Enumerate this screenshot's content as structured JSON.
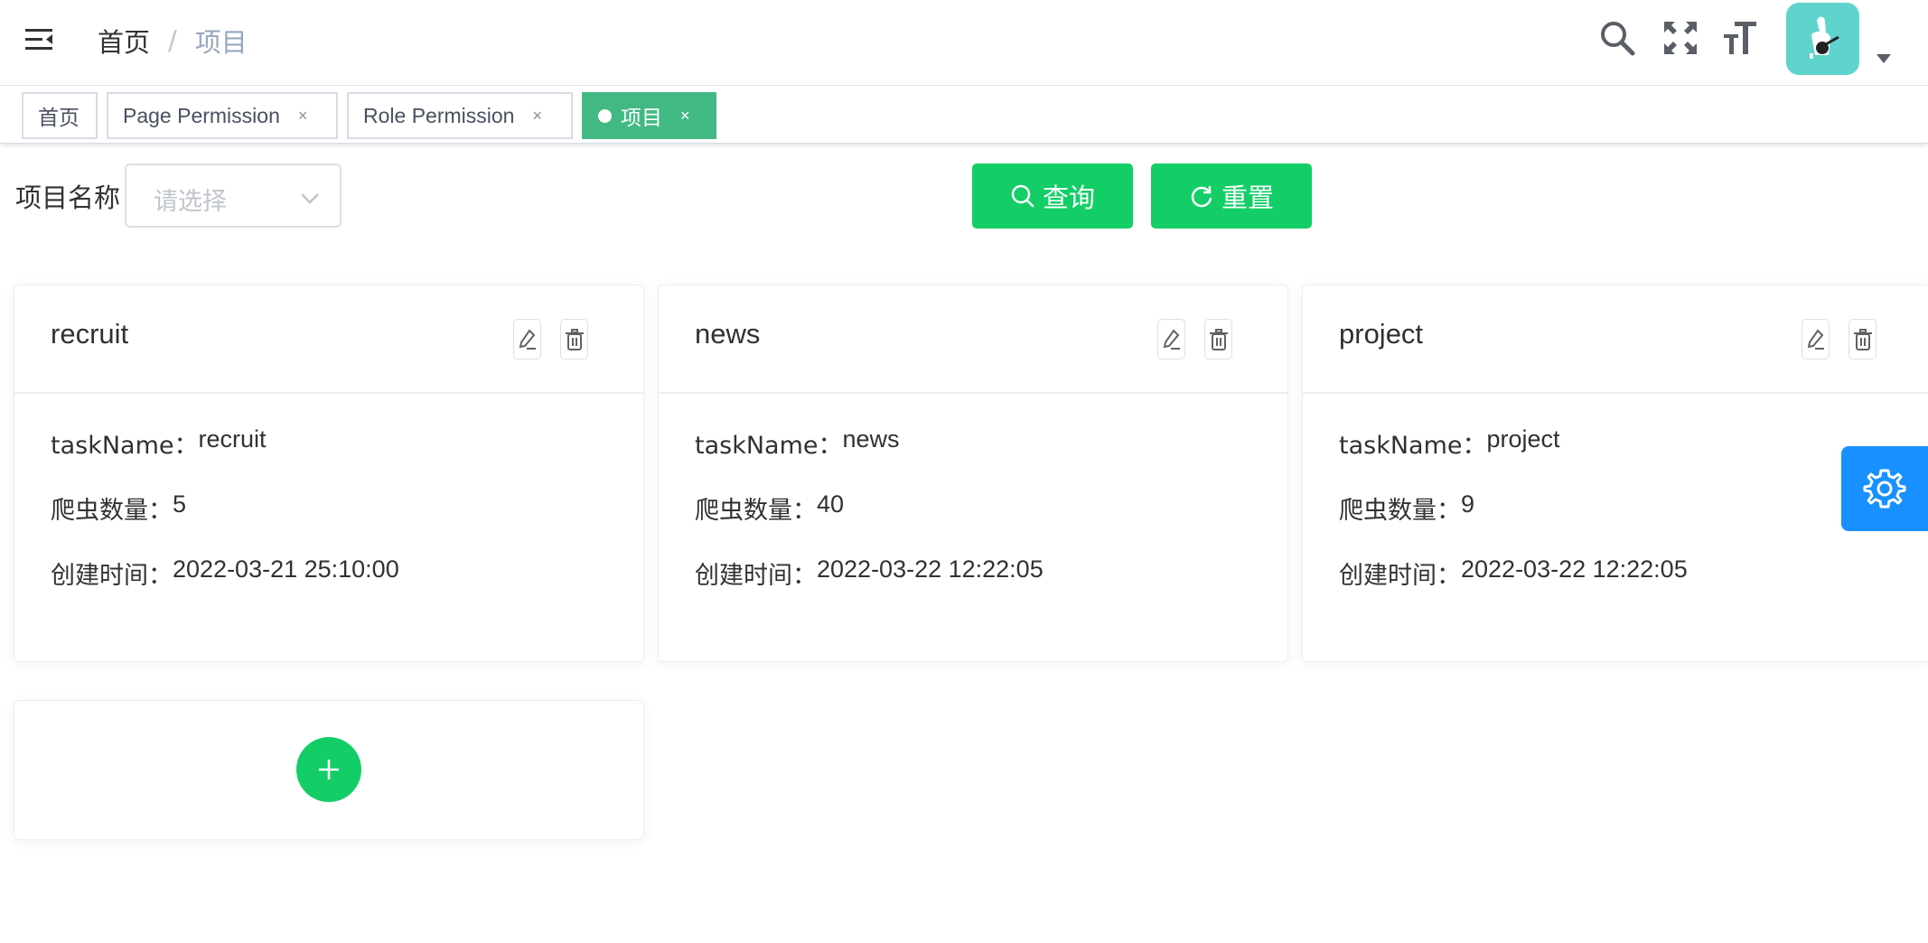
{
  "navbar": {
    "breadcrumb": {
      "home": "首页",
      "separator": "/",
      "current": "项目"
    },
    "icons": [
      "hamburger-icon",
      "search-icon",
      "fullscreen-icon",
      "font-size-icon"
    ]
  },
  "tags": [
    {
      "label": "首页",
      "closable": false,
      "active": false
    },
    {
      "label": "Page Permission",
      "closable": true,
      "active": false
    },
    {
      "label": "Role Permission",
      "closable": true,
      "active": false
    },
    {
      "label": "项目",
      "closable": true,
      "active": true
    }
  ],
  "tag_close_glyph": "×",
  "filter": {
    "label": "项目名称",
    "placeholder": "请选择",
    "search_label": "查询",
    "reset_label": "重置"
  },
  "row_labels": {
    "task_name": "taskName：",
    "spider_count": "爬虫数量：",
    "created": "创建时间："
  },
  "cards": [
    {
      "title": "recruit",
      "task_name": "recruit",
      "spider_count": "5",
      "created": "2022-03-21 25:10:00"
    },
    {
      "title": "news",
      "task_name": "news",
      "spider_count": "40",
      "created": "2022-03-22 12:22:05"
    },
    {
      "title": "project",
      "task_name": "project",
      "spider_count": "9",
      "created": "2022-03-22 12:22:05"
    }
  ],
  "colors": {
    "accent": "#13ce66",
    "active_tag": "#42b983",
    "settings": "#1890ff",
    "avatar": "#5fd4cc"
  }
}
